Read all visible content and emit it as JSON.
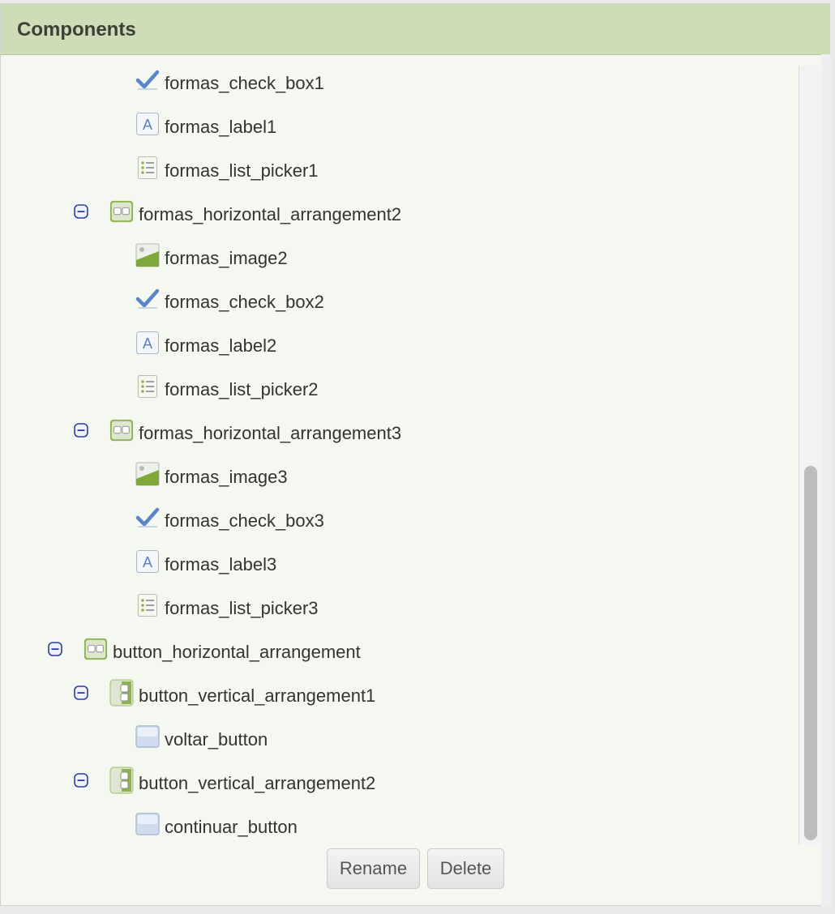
{
  "panel": {
    "title": "Components"
  },
  "tree": {
    "items": [
      {
        "label": "formas_check_box1",
        "type": "checkbox",
        "level": 3
      },
      {
        "label": "formas_label1",
        "type": "label",
        "level": 3
      },
      {
        "label": "formas_list_picker1",
        "type": "listpicker",
        "level": 3
      },
      {
        "label": "formas_horizontal_arrangement2",
        "type": "horizontal",
        "level": 2,
        "expanded": true
      },
      {
        "label": "formas_image2",
        "type": "image",
        "level": 3
      },
      {
        "label": "formas_check_box2",
        "type": "checkbox",
        "level": 3
      },
      {
        "label": "formas_label2",
        "type": "label",
        "level": 3
      },
      {
        "label": "formas_list_picker2",
        "type": "listpicker",
        "level": 3
      },
      {
        "label": "formas_horizontal_arrangement3",
        "type": "horizontal",
        "level": 2,
        "expanded": true
      },
      {
        "label": "formas_image3",
        "type": "image",
        "level": 3
      },
      {
        "label": "formas_check_box3",
        "type": "checkbox",
        "level": 3
      },
      {
        "label": "formas_label3",
        "type": "label",
        "level": 3
      },
      {
        "label": "formas_list_picker3",
        "type": "listpicker",
        "level": 3
      },
      {
        "label": "button_horizontal_arrangement",
        "type": "horizontal",
        "level": 1,
        "expanded": true
      },
      {
        "label": "button_vertical_arrangement1",
        "type": "vertical",
        "level": 2,
        "expanded": true
      },
      {
        "label": "voltar_button",
        "type": "button",
        "level": 3
      },
      {
        "label": "button_vertical_arrangement2",
        "type": "vertical",
        "level": 2,
        "expanded": true
      },
      {
        "label": "continuar_button",
        "type": "button",
        "level": 3
      }
    ]
  },
  "actions": {
    "rename_label": "Rename",
    "delete_label": "Delete"
  }
}
